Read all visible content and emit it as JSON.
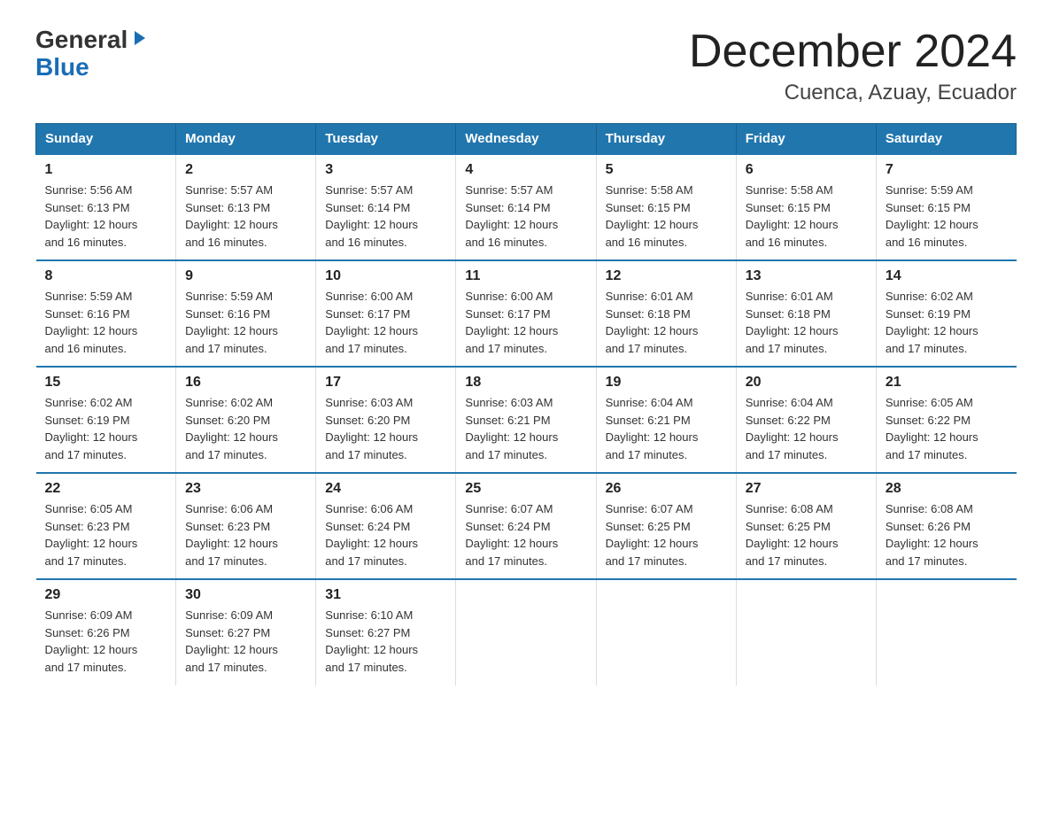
{
  "logo": {
    "general": "General",
    "blue": "Blue",
    "triangle": "▶"
  },
  "title": "December 2024",
  "subtitle": "Cuenca, Azuay, Ecuador",
  "headers": [
    "Sunday",
    "Monday",
    "Tuesday",
    "Wednesday",
    "Thursday",
    "Friday",
    "Saturday"
  ],
  "weeks": [
    [
      {
        "day": "1",
        "info": "Sunrise: 5:56 AM\nSunset: 6:13 PM\nDaylight: 12 hours\nand 16 minutes."
      },
      {
        "day": "2",
        "info": "Sunrise: 5:57 AM\nSunset: 6:13 PM\nDaylight: 12 hours\nand 16 minutes."
      },
      {
        "day": "3",
        "info": "Sunrise: 5:57 AM\nSunset: 6:14 PM\nDaylight: 12 hours\nand 16 minutes."
      },
      {
        "day": "4",
        "info": "Sunrise: 5:57 AM\nSunset: 6:14 PM\nDaylight: 12 hours\nand 16 minutes."
      },
      {
        "day": "5",
        "info": "Sunrise: 5:58 AM\nSunset: 6:15 PM\nDaylight: 12 hours\nand 16 minutes."
      },
      {
        "day": "6",
        "info": "Sunrise: 5:58 AM\nSunset: 6:15 PM\nDaylight: 12 hours\nand 16 minutes."
      },
      {
        "day": "7",
        "info": "Sunrise: 5:59 AM\nSunset: 6:15 PM\nDaylight: 12 hours\nand 16 minutes."
      }
    ],
    [
      {
        "day": "8",
        "info": "Sunrise: 5:59 AM\nSunset: 6:16 PM\nDaylight: 12 hours\nand 16 minutes."
      },
      {
        "day": "9",
        "info": "Sunrise: 5:59 AM\nSunset: 6:16 PM\nDaylight: 12 hours\nand 17 minutes."
      },
      {
        "day": "10",
        "info": "Sunrise: 6:00 AM\nSunset: 6:17 PM\nDaylight: 12 hours\nand 17 minutes."
      },
      {
        "day": "11",
        "info": "Sunrise: 6:00 AM\nSunset: 6:17 PM\nDaylight: 12 hours\nand 17 minutes."
      },
      {
        "day": "12",
        "info": "Sunrise: 6:01 AM\nSunset: 6:18 PM\nDaylight: 12 hours\nand 17 minutes."
      },
      {
        "day": "13",
        "info": "Sunrise: 6:01 AM\nSunset: 6:18 PM\nDaylight: 12 hours\nand 17 minutes."
      },
      {
        "day": "14",
        "info": "Sunrise: 6:02 AM\nSunset: 6:19 PM\nDaylight: 12 hours\nand 17 minutes."
      }
    ],
    [
      {
        "day": "15",
        "info": "Sunrise: 6:02 AM\nSunset: 6:19 PM\nDaylight: 12 hours\nand 17 minutes."
      },
      {
        "day": "16",
        "info": "Sunrise: 6:02 AM\nSunset: 6:20 PM\nDaylight: 12 hours\nand 17 minutes."
      },
      {
        "day": "17",
        "info": "Sunrise: 6:03 AM\nSunset: 6:20 PM\nDaylight: 12 hours\nand 17 minutes."
      },
      {
        "day": "18",
        "info": "Sunrise: 6:03 AM\nSunset: 6:21 PM\nDaylight: 12 hours\nand 17 minutes."
      },
      {
        "day": "19",
        "info": "Sunrise: 6:04 AM\nSunset: 6:21 PM\nDaylight: 12 hours\nand 17 minutes."
      },
      {
        "day": "20",
        "info": "Sunrise: 6:04 AM\nSunset: 6:22 PM\nDaylight: 12 hours\nand 17 minutes."
      },
      {
        "day": "21",
        "info": "Sunrise: 6:05 AM\nSunset: 6:22 PM\nDaylight: 12 hours\nand 17 minutes."
      }
    ],
    [
      {
        "day": "22",
        "info": "Sunrise: 6:05 AM\nSunset: 6:23 PM\nDaylight: 12 hours\nand 17 minutes."
      },
      {
        "day": "23",
        "info": "Sunrise: 6:06 AM\nSunset: 6:23 PM\nDaylight: 12 hours\nand 17 minutes."
      },
      {
        "day": "24",
        "info": "Sunrise: 6:06 AM\nSunset: 6:24 PM\nDaylight: 12 hours\nand 17 minutes."
      },
      {
        "day": "25",
        "info": "Sunrise: 6:07 AM\nSunset: 6:24 PM\nDaylight: 12 hours\nand 17 minutes."
      },
      {
        "day": "26",
        "info": "Sunrise: 6:07 AM\nSunset: 6:25 PM\nDaylight: 12 hours\nand 17 minutes."
      },
      {
        "day": "27",
        "info": "Sunrise: 6:08 AM\nSunset: 6:25 PM\nDaylight: 12 hours\nand 17 minutes."
      },
      {
        "day": "28",
        "info": "Sunrise: 6:08 AM\nSunset: 6:26 PM\nDaylight: 12 hours\nand 17 minutes."
      }
    ],
    [
      {
        "day": "29",
        "info": "Sunrise: 6:09 AM\nSunset: 6:26 PM\nDaylight: 12 hours\nand 17 minutes."
      },
      {
        "day": "30",
        "info": "Sunrise: 6:09 AM\nSunset: 6:27 PM\nDaylight: 12 hours\nand 17 minutes."
      },
      {
        "day": "31",
        "info": "Sunrise: 6:10 AM\nSunset: 6:27 PM\nDaylight: 12 hours\nand 17 minutes."
      },
      {
        "day": "",
        "info": ""
      },
      {
        "day": "",
        "info": ""
      },
      {
        "day": "",
        "info": ""
      },
      {
        "day": "",
        "info": ""
      }
    ]
  ]
}
